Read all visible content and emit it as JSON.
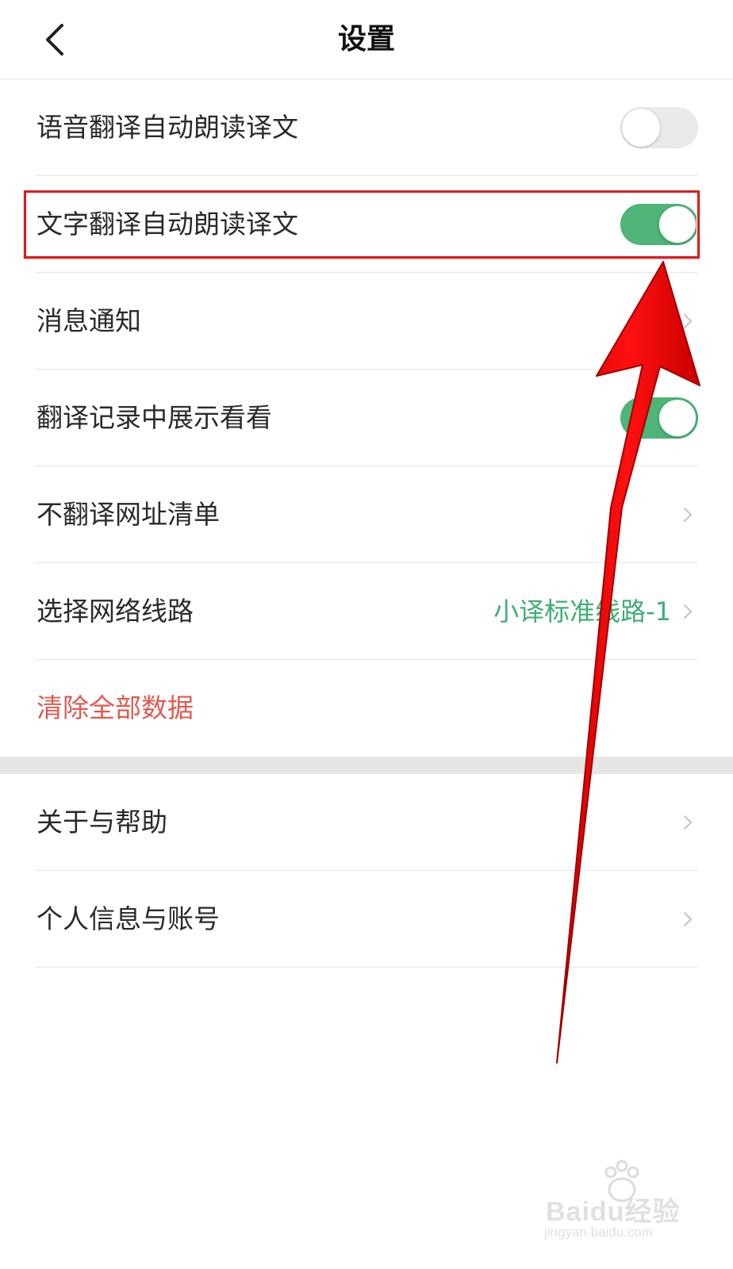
{
  "header": {
    "title": "设置"
  },
  "settings_group_1": [
    {
      "label": "语音翻译自动朗读译文",
      "type": "toggle",
      "on": false
    },
    {
      "label": "文字翻译自动朗读译文",
      "type": "toggle",
      "on": true
    },
    {
      "label": "消息通知",
      "type": "link"
    },
    {
      "label": "翻译记录中展示看看",
      "type": "toggle",
      "on": true
    },
    {
      "label": "不翻译网址清单",
      "type": "link"
    },
    {
      "label": "选择网络线路",
      "type": "link",
      "value": "小译标准线路-1"
    },
    {
      "label": "清除全部数据",
      "type": "danger"
    }
  ],
  "settings_group_2": [
    {
      "label": "关于与帮助",
      "type": "link"
    },
    {
      "label": "个人信息与账号",
      "type": "link"
    }
  ],
  "watermark": {
    "brand": "Baidu经验",
    "url": "jingyan.baidu.com"
  },
  "colors": {
    "toggle_on": "#4fb478",
    "toggle_off": "#e9e9e9",
    "value_text": "#3fae72",
    "danger_text": "#e0594f",
    "annotation_red": "#e0191b"
  },
  "icons": {
    "back": "chevron-left-icon",
    "row_arrow": "chevron-right-icon"
  }
}
